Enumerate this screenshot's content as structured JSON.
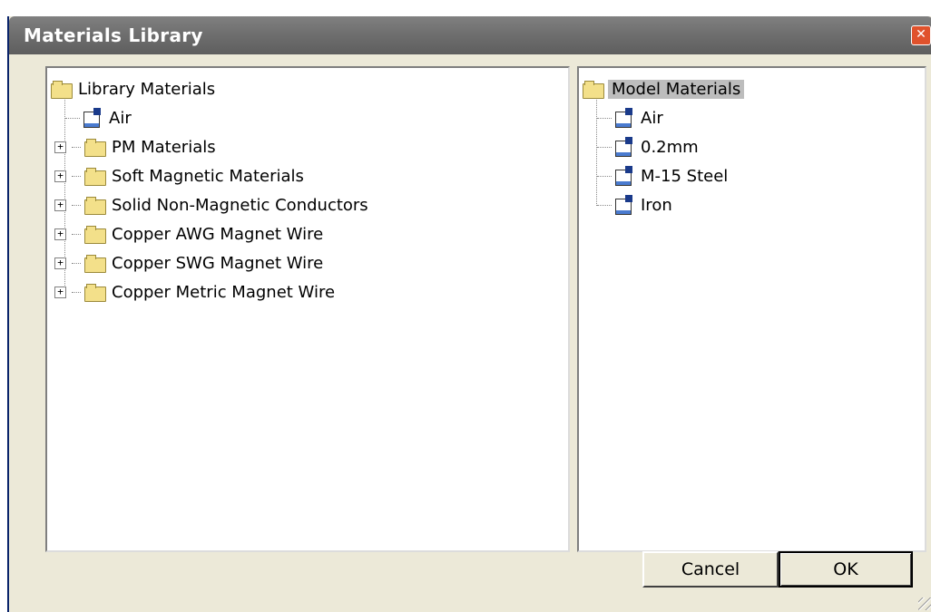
{
  "window": {
    "title": "Materials Library",
    "close_label": "✕"
  },
  "library_tree": {
    "root": "Library Materials",
    "items": [
      {
        "label": "Air",
        "type": "material"
      },
      {
        "label": "PM Materials",
        "type": "folder",
        "expander": "+"
      },
      {
        "label": "Soft Magnetic Materials",
        "type": "folder",
        "expander": "+"
      },
      {
        "label": "Solid Non-Magnetic Conductors",
        "type": "folder",
        "expander": "+"
      },
      {
        "label": "Copper AWG Magnet Wire",
        "type": "folder",
        "expander": "+"
      },
      {
        "label": "Copper SWG Magnet Wire",
        "type": "folder",
        "expander": "+"
      },
      {
        "label": "Copper Metric Magnet Wire",
        "type": "folder",
        "expander": "+"
      }
    ]
  },
  "model_tree": {
    "root": "Model Materials",
    "items": [
      {
        "label": "Air",
        "type": "material"
      },
      {
        "label": "0.2mm",
        "type": "material"
      },
      {
        "label": "M-15 Steel",
        "type": "material"
      },
      {
        "label": "Iron",
        "type": "material"
      }
    ]
  },
  "buttons": {
    "cancel": "Cancel",
    "ok": "OK"
  },
  "colors": {
    "title_bar": "#6f6f6f",
    "dialog_bg": "#ece9d8",
    "selected_bg": "#bdbdbd",
    "folder": "#f3e08a"
  }
}
